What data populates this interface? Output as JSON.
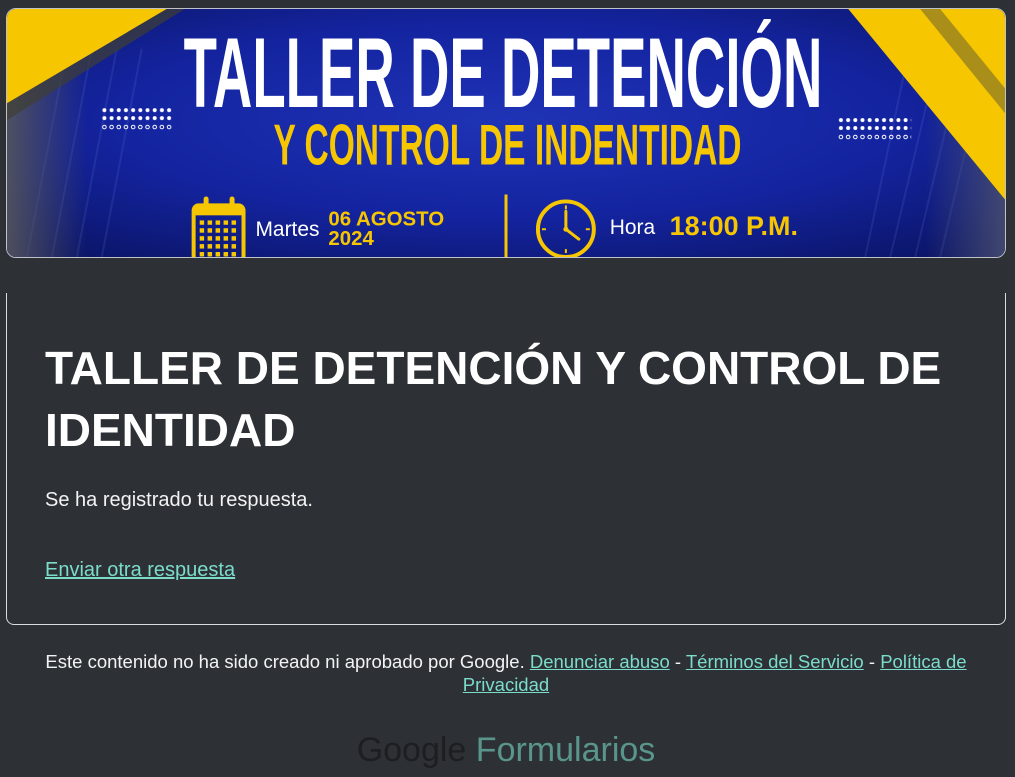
{
  "colors": {
    "page_background": "#2d3135",
    "card_border": "#dadce0",
    "text": "#ffffff",
    "link": "#7bdcca",
    "banner_blue": "#1424a0",
    "banner_yellow": "#f6c600",
    "logo_google": "#1c1e21",
    "logo_product": "#5a958c"
  },
  "banner": {
    "title": "TALLER DE DETENCIÓN",
    "subtitle": "Y CONTROL DE INDENTIDAD",
    "day_label": "Martes",
    "date_line1": "06 AGOSTO",
    "date_line2": "2024",
    "time_label": "Hora",
    "time_value": "18:00 P.M.",
    "icons": {
      "date": "calendar-icon",
      "time": "clock-icon"
    }
  },
  "form": {
    "title": "TALLER DE DETENCIÓN Y CONTROL DE IDENTIDAD",
    "confirmation_message": "Se ha registrado tu respuesta.",
    "submit_another_link": "Enviar otra respuesta"
  },
  "footer": {
    "disclaimer": "Este contenido no ha sido creado ni aprobado por Google.",
    "separator": "-",
    "links": [
      "Denunciar abuso",
      "Términos del Servicio",
      "Política de Privacidad"
    ]
  },
  "branding": {
    "logo_word_1": "Google",
    "logo_word_2": "Formularios"
  }
}
